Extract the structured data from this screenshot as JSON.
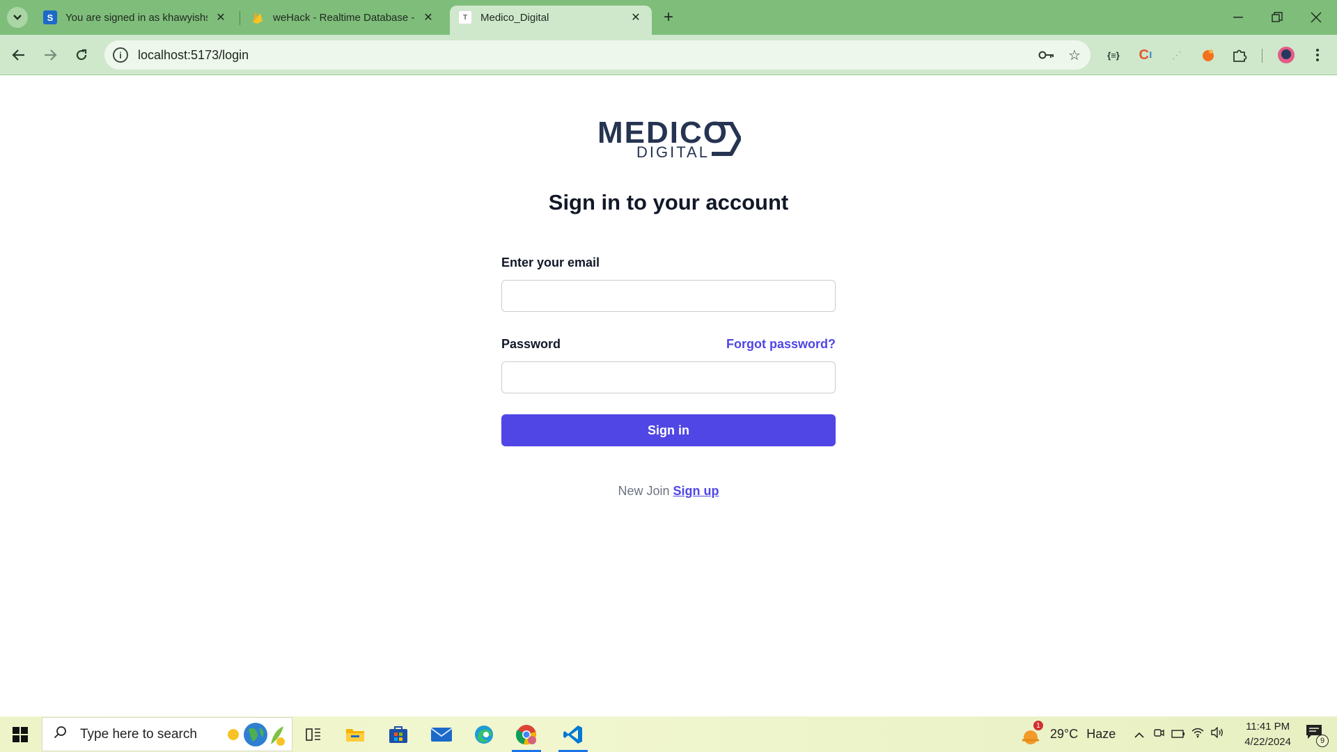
{
  "browser": {
    "tabs": [
      {
        "title": "You are signed in as khawyishs",
        "favicon": "S"
      },
      {
        "title": "weHack - Realtime Database -",
        "favicon": ""
      },
      {
        "title": "Medico_Digital",
        "favicon": "T"
      }
    ],
    "url": "localhost:5173/login"
  },
  "page": {
    "logo_main": "MEDICO",
    "logo_sub": "DIGITAL",
    "heading": "Sign in to your account",
    "email_label": "Enter your email",
    "email_value": "",
    "password_label": "Password",
    "password_value": "",
    "forgot_link": "Forgot password?",
    "signin_button": "Sign in",
    "signup_prefix": "New Join",
    "signup_link": "Sign up"
  },
  "taskbar": {
    "search_placeholder": "Type here to search",
    "weather_temp": "29°C",
    "weather_desc": "Haze",
    "weather_alert_count": "1",
    "time": "11:41 PM",
    "date": "4/22/2024",
    "notification_count": "9"
  },
  "colors": {
    "accent": "#4f46e5",
    "browser_frame": "#7fbd7b",
    "logo": "#263452"
  }
}
